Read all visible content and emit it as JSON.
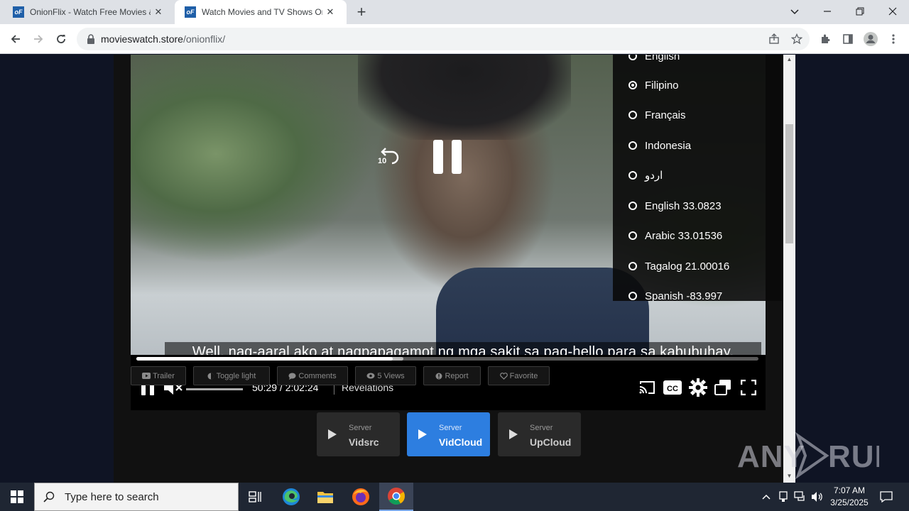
{
  "browser": {
    "tabs": [
      {
        "title": "OnionFlix - Watch Free Movies &",
        "favicon": "oF"
      },
      {
        "title": "Watch Movies and TV Shows On",
        "favicon": "oF"
      }
    ],
    "url_host": "movieswatch.store",
    "url_path": "/onionflix/"
  },
  "player": {
    "subtitle": "Well, nag-aaral ako at nagpapagamot ng mga sakit sa pag-hello para sa kabubuhay.",
    "replay_label": "10",
    "time": "50:29 / 2:02:24",
    "chapter": "Revelations",
    "progress_played": 0.412,
    "progress_buffered": 0.429,
    "volume_muted": true,
    "subtitle_menu": [
      {
        "label": "English",
        "selected": false
      },
      {
        "label": "Filipino",
        "selected": true
      },
      {
        "label": "Français",
        "selected": false
      },
      {
        "label": "Indonesia",
        "selected": false
      },
      {
        "label": "اردو",
        "selected": false
      },
      {
        "label": "English 33.0823",
        "selected": false
      },
      {
        "label": "Arabic 33.01536",
        "selected": false
      },
      {
        "label": "Tagalog 21.00016",
        "selected": false
      },
      {
        "label": "Spanish -83.997",
        "selected": false
      }
    ]
  },
  "actions": [
    {
      "label": "Trailer",
      "icon": "youtube-icon"
    },
    {
      "label": "Toggle light",
      "icon": "bulb-icon"
    },
    {
      "label": "Comments",
      "icon": "comment-icon"
    },
    {
      "label": "5 Views",
      "icon": "eye-icon"
    },
    {
      "label": "Report",
      "icon": "warning-icon"
    },
    {
      "label": "Favorite",
      "icon": "heart-icon"
    }
  ],
  "servers": [
    {
      "small": "Server",
      "name": "Vidsrc",
      "active": false
    },
    {
      "small": "Server",
      "name": "VidCloud",
      "active": true
    },
    {
      "small": "Server",
      "name": "UpCloud",
      "active": false
    }
  ],
  "watermark": "ANY RUN",
  "taskbar": {
    "search_placeholder": "Type here to search",
    "time": "7:07 AM",
    "date": "3/25/2025"
  },
  "colors": {
    "accent": "#2d7ee0",
    "page_bg": "#0f1424",
    "taskbar": "#1f2633"
  }
}
